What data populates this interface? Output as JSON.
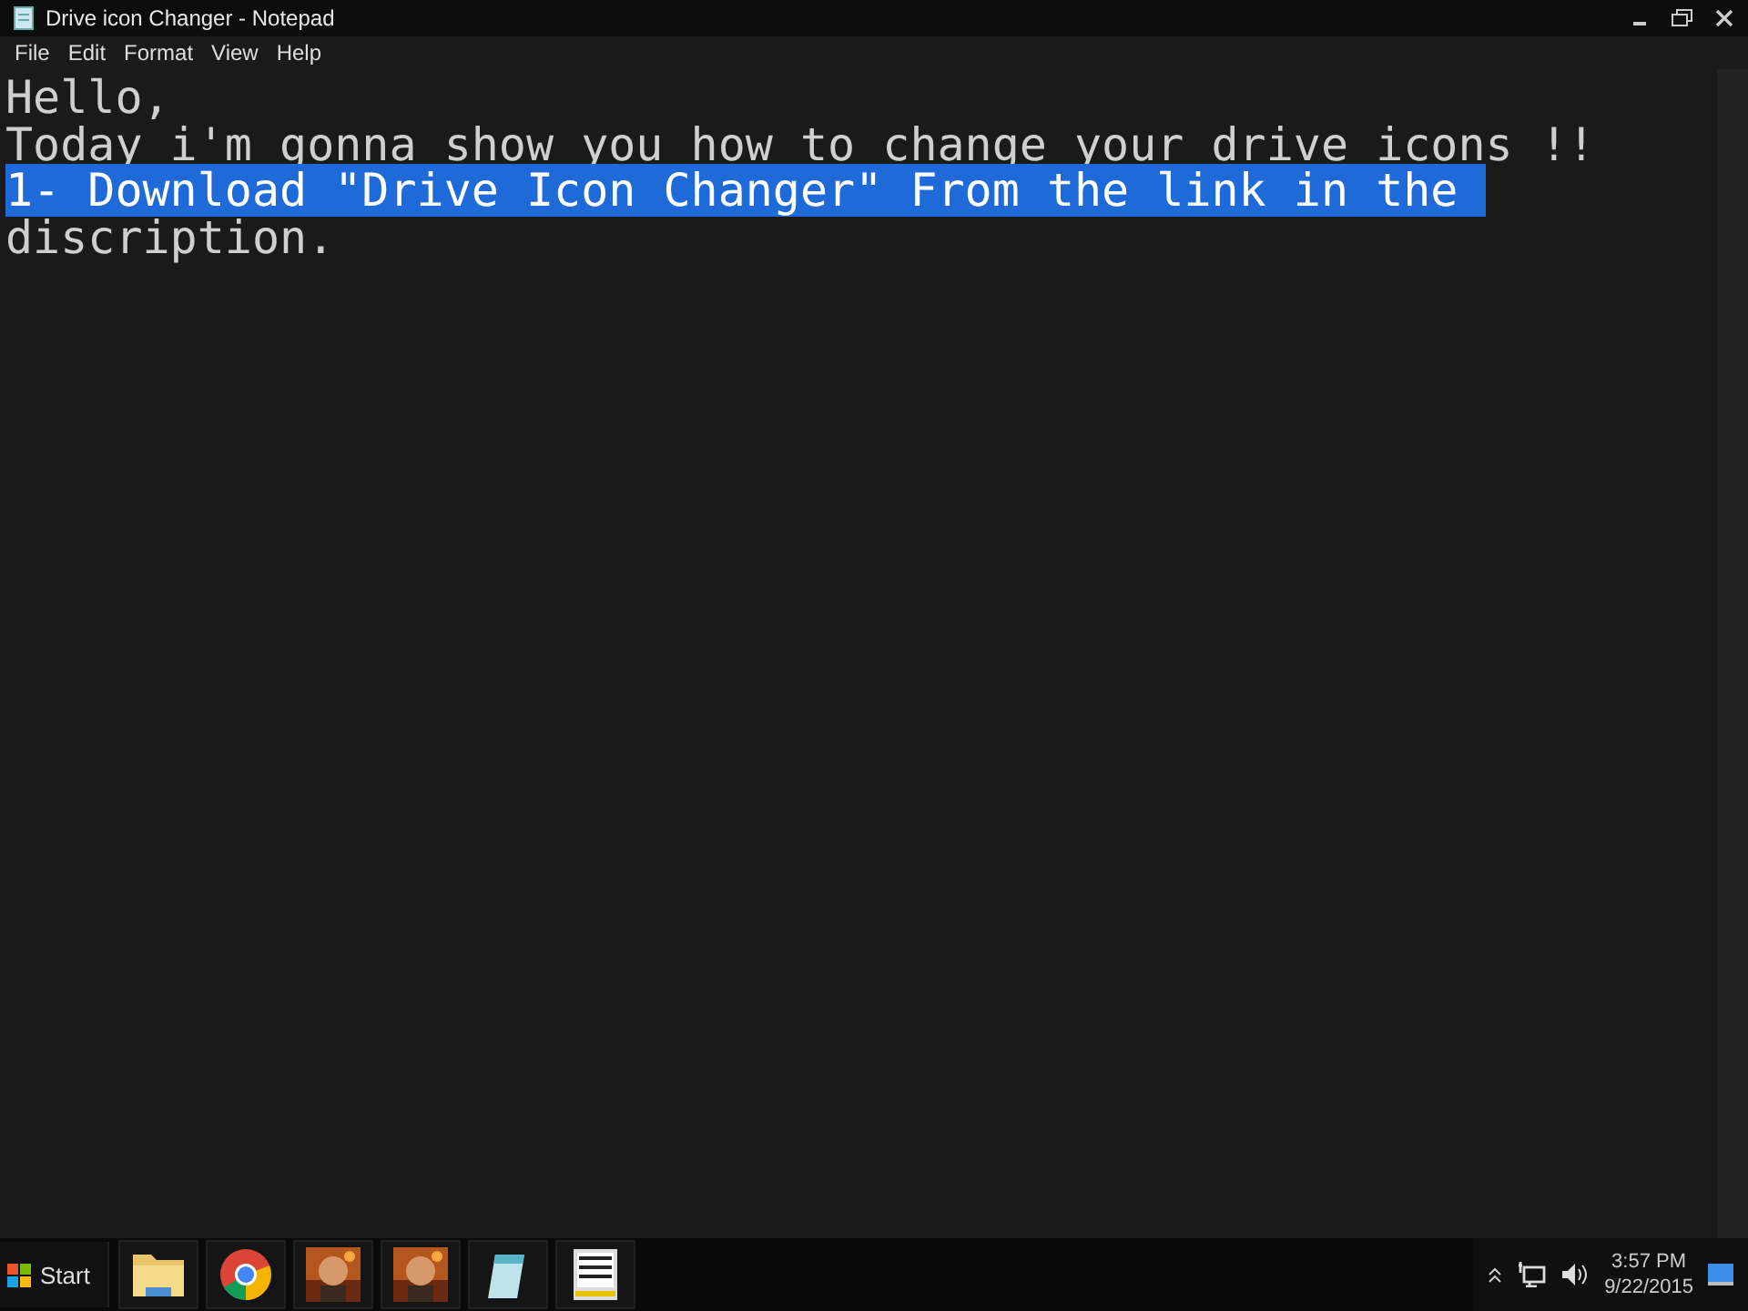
{
  "window": {
    "title": "Drive icon Changer - Notepad"
  },
  "menu": [
    "File",
    "Edit",
    "Format",
    "View",
    "Help"
  ],
  "editor": {
    "lines": [
      {
        "text": "Hello,",
        "selected": false
      },
      {
        "text": "Today i'm gonna show you how to change your drive icons !!",
        "selected": false
      },
      {
        "text": "1- Download \"Drive Icon Changer\" From the link in the ",
        "selected": true
      },
      {
        "text": "discription.",
        "selected": false
      }
    ]
  },
  "taskbar": {
    "start": "Start",
    "apps": [
      {
        "kind": "folder"
      },
      {
        "kind": "browser"
      },
      {
        "kind": "picture"
      },
      {
        "kind": "picture"
      },
      {
        "kind": "notepad"
      },
      {
        "kind": "drive"
      }
    ],
    "time": "3:57 PM",
    "date": "9/22/2015"
  }
}
